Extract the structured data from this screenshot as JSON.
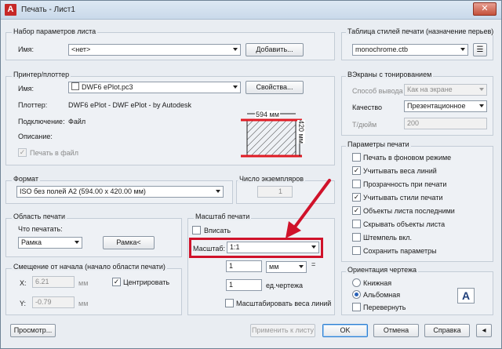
{
  "window": {
    "title": "Печать - Лист1"
  },
  "page_setup": {
    "title": "Набор параметров листа",
    "name_label": "Имя:",
    "name_value": "<нет>",
    "add_button": "Добавить..."
  },
  "printer": {
    "title": "Принтер/плоттер",
    "name_label": "Имя:",
    "name_value": "DWF6 ePlot.pc3",
    "properties_button": "Свойства...",
    "plotter_label": "Плоттер:",
    "plotter_value": "DWF6 ePlot - DWF ePlot - by Autodesk",
    "connection_label": "Подключение:",
    "connection_value": "Файл",
    "description_label": "Описание:",
    "print_to_file": "Печать в файл",
    "preview_width": "594 мм",
    "preview_height": "420 мм"
  },
  "format": {
    "title": "Формат",
    "value": "ISO без полей A2 (594.00 x 420.00 мм)"
  },
  "copies": {
    "title": "Число экземпляров",
    "value": "1"
  },
  "print_area": {
    "title": "Область печати",
    "what_label": "Что печатать:",
    "what_value": "Рамка",
    "frame_button": "Рамка<"
  },
  "scale": {
    "title": "Масштаб печати",
    "fit_label": "Вписать",
    "scale_label": "Масштаб:",
    "scale_value": "1:1",
    "value1": "1",
    "unit_value": "мм",
    "value2": "1",
    "unit2": "ед.чертежа",
    "scale_lineweights": "Масштабировать веса линий"
  },
  "offset": {
    "title": "Смещение от начала (начало области печати)",
    "x_label": "X:",
    "x_value": "6.21",
    "x_unit": "мм",
    "y_label": "Y:",
    "y_value": "-0.79",
    "y_unit": "мм",
    "center_label": "Центрировать"
  },
  "plot_style": {
    "title": "Таблица стилей печати (назначение перьев)",
    "value": "monochrome.ctb"
  },
  "shaded": {
    "title": "ВЭкраны с тонированием",
    "output_label": "Способ вывода",
    "output_value": "Как на экране",
    "quality_label": "Качество",
    "quality_value": "Презентационное",
    "dpi_label": "Т/дюйм",
    "dpi_value": "200"
  },
  "options": {
    "title": "Параметры печати",
    "items": [
      {
        "label": "Печать в фоновом режиме",
        "checked": false
      },
      {
        "label": "Учитывать веса линий",
        "checked": true
      },
      {
        "label": "Прозрачность при печати",
        "checked": false
      },
      {
        "label": "Учитывать стили печати",
        "checked": true
      },
      {
        "label": "Объекты листа последними",
        "checked": true
      },
      {
        "label": "Скрывать объекты листа",
        "checked": false
      },
      {
        "label": "Штемпель вкл.",
        "checked": false
      },
      {
        "label": "Сохранить параметры",
        "checked": false
      }
    ]
  },
  "orientation": {
    "title": "Ориентация чертежа",
    "portrait": "Книжная",
    "landscape": "Альбомная",
    "upside_down": "Перевернуть",
    "selected": "landscape",
    "badge": "A"
  },
  "footer": {
    "preview": "Просмотр...",
    "apply": "Применить к листу",
    "ok": "OK",
    "cancel": "Отмена",
    "help": "Справка"
  },
  "colors": {
    "highlight": "#d0122a",
    "red_line": "#e01b24",
    "titlebar": "#c9d9ea"
  }
}
